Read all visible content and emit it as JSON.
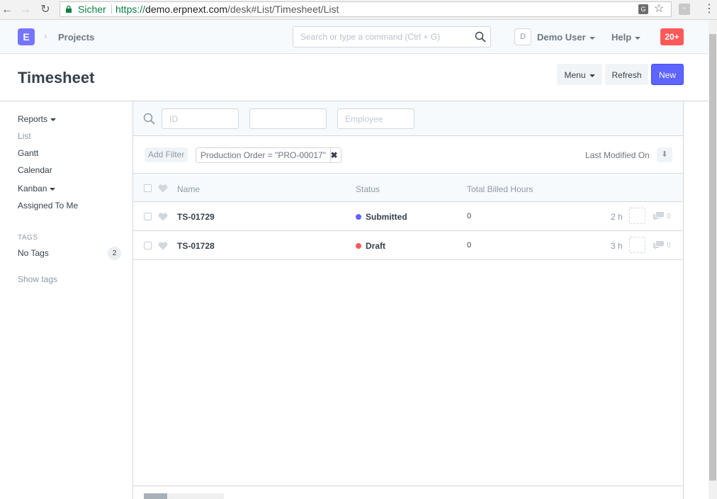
{
  "browser": {
    "secure_label": "Sicher",
    "url_scheme": "https://",
    "url_host": "demo.erpnext.com",
    "url_path": "/desk#List/Timesheet/List"
  },
  "navbar": {
    "logo_letter": "E",
    "breadcrumb": "Projects",
    "search_placeholder": "Search or type a command (Ctrl + G)",
    "avatar_letter": "D",
    "user_name": "Demo User",
    "help_label": "Help",
    "notification_count": "20+"
  },
  "page": {
    "title": "Timesheet",
    "menu_label": "Menu",
    "refresh_label": "Refresh",
    "new_label": "New"
  },
  "sidebar": {
    "items": [
      {
        "label": "Reports"
      },
      {
        "label": "List"
      },
      {
        "label": "Gantt"
      },
      {
        "label": "Calendar"
      },
      {
        "label": "Kanban"
      },
      {
        "label": "Assigned To Me"
      }
    ],
    "tags_heading": "TAGS",
    "no_tags_label": "No Tags",
    "no_tags_count": "2",
    "show_tags_label": "Show tags"
  },
  "filters": {
    "id_placeholder": "ID",
    "field2_placeholder": "",
    "employee_placeholder": "Employee",
    "add_filter_label": "Add Filter",
    "active_filter": "Production Order = \"PRO-00017\"",
    "sort_label": "Last Modified On"
  },
  "list": {
    "columns": [
      "Name",
      "Status",
      "Total Billed Hours"
    ],
    "rows": [
      {
        "name": "TS-01729",
        "status": "Submitted",
        "status_color": "#5e64ff",
        "billed_hours": "0",
        "modified": "2 h",
        "comments": "0"
      },
      {
        "name": "TS-01728",
        "status": "Draft",
        "status_color": "#ff5858",
        "billed_hours": "0",
        "modified": "3 h",
        "comments": "0"
      }
    ]
  },
  "colors": {
    "accent": "#5e64ff",
    "logo": "#7575ff",
    "notification": "#ff5858"
  }
}
